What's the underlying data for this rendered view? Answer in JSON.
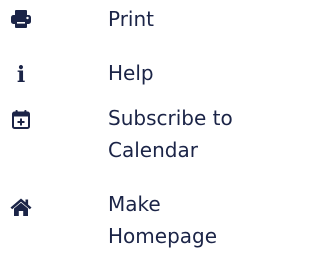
{
  "menu": {
    "items": [
      {
        "icon": "print-icon",
        "label": "Print"
      },
      {
        "icon": "info-icon",
        "label": "Help"
      },
      {
        "icon": "calendar-plus-icon",
        "label": "Subscribe to Calendar"
      },
      {
        "icon": "home-icon",
        "label": "Make Homepage"
      }
    ]
  },
  "colors": {
    "text": "#1b2447",
    "icon": "#1b2447",
    "background": "#ffffff"
  }
}
